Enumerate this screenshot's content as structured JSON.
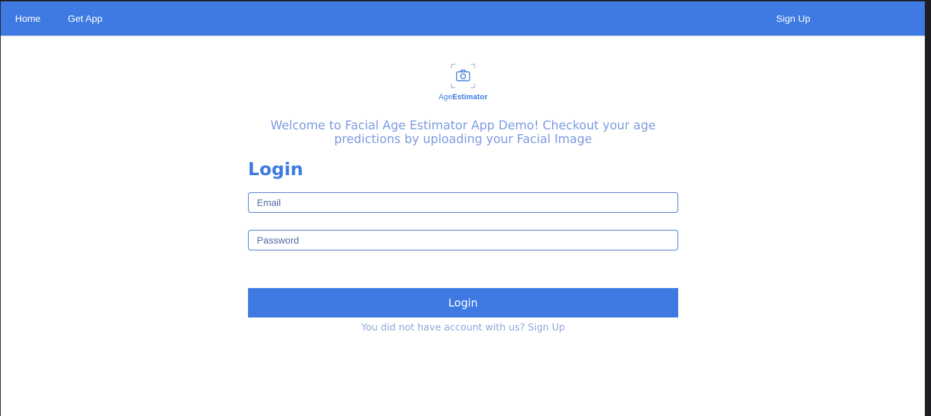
{
  "nav": {
    "home_label": "Home",
    "get_app_label": "Get App",
    "sign_up_label": "Sign Up"
  },
  "logo": {
    "icon": "camera-icon",
    "text_prefix": "Age",
    "text_bold": "Estimator"
  },
  "welcome_text": "Welcome to Facial Age Estimator App Demo! Checkout your age predictions by uploading your Facial Image",
  "login": {
    "title": "Login",
    "email_placeholder": "Email",
    "password_placeholder": "Password",
    "button_label": "Login",
    "hint_text": "You did not have account with us?",
    "hint_link": "Sign Up"
  },
  "colors": {
    "primary": "#3e7ae1",
    "muted_text": "#7b9be0"
  }
}
